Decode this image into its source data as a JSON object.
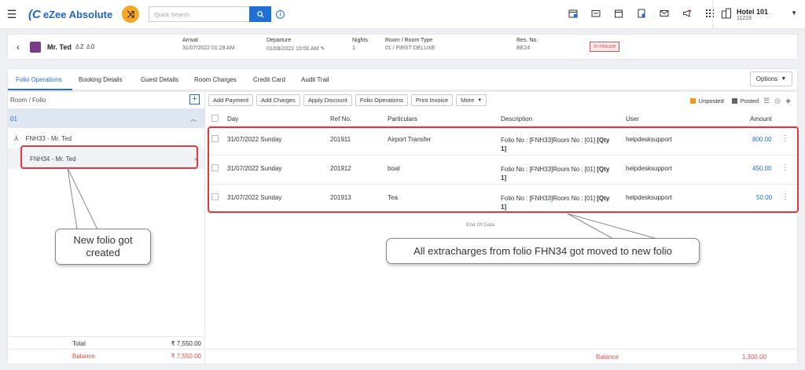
{
  "topbar": {
    "brand": "eZee Absolute",
    "search_placeholder": "Quick Search",
    "hotel_name": "Hotel 101",
    "hotel_code": "11219"
  },
  "guest": {
    "name": "Mr. Ted",
    "adults": "2",
    "children": "0",
    "arrival_label": "Arrival",
    "arrival_value": "31/07/2022 01:28 AM",
    "departure_label": "Departure",
    "departure_value": "01/08/2022 10:00 AM",
    "nights_label": "Nights",
    "nights_value": "1",
    "room_label": "Room / Room Type",
    "room_value": "01 / FIRST DELUXE",
    "resno_label": "Res. No.",
    "resno_value": "BE24",
    "status": "In-House"
  },
  "tabs": [
    {
      "label": "Folio Operations"
    },
    {
      "label": "Booking Details"
    },
    {
      "label": "Guest Details"
    },
    {
      "label": "Room Charges"
    },
    {
      "label": "Credit Card"
    },
    {
      "label": "Audit Trail"
    }
  ],
  "options_label": "Options",
  "left_panel": {
    "header": "Room / Folio",
    "group": "01",
    "folios": [
      "FNH33 - Mr. Ted",
      "FNH34 - Mr. Ted"
    ],
    "total_label": "Total",
    "total_value": "₹ 7,550.00",
    "balance_label": "Balance",
    "balance_value": "₹ 7,550.00"
  },
  "actions": [
    "Add Payment",
    "Add Charges",
    "Apply Discount",
    "Folio Operations",
    "Print Invoice",
    "More"
  ],
  "legend": {
    "unposted": "Unposted",
    "posted": "Posted"
  },
  "table": {
    "headers": {
      "day": "Day",
      "ref": "Ref No.",
      "particulars": "Particulars",
      "description": "Description",
      "user": "User",
      "amount": "Amount"
    },
    "rows": [
      {
        "day": "31/07/2022 Sunday",
        "ref": "201911",
        "particulars": "Airport Transfer",
        "desc_a": "Folio No : [FNH33]Room No : [01] ",
        "desc_b": "[Qty",
        "desc_c": "1]",
        "user": "helpdesksupport",
        "amount": "800.00"
      },
      {
        "day": "31/07/2022 Sunday",
        "ref": "201912",
        "particulars": "boat",
        "desc_a": "Folio No : [FNH33]Room No : [01] ",
        "desc_b": "[Qty",
        "desc_c": "1]",
        "user": "helpdesksupport",
        "amount": "450.00"
      },
      {
        "day": "31/07/2022 Sunday",
        "ref": "201913",
        "particulars": "Tea",
        "desc_a": "Folio No : [FNH33]Room No : [01] ",
        "desc_b": "[Qty",
        "desc_c": "1]",
        "user": "helpdesksupport",
        "amount": "50.00"
      }
    ],
    "end_text": "End Of Data",
    "balance_label": "Balance",
    "balance_value": "1,300.00"
  },
  "annotations": {
    "new_folio": "New folio got created",
    "moved": "All extracharges from folio FHN34 got moved to new folio"
  },
  "colors": {
    "accent": "#1f6fd6",
    "highlight": "#e0383e",
    "unposted": "#f39c12"
  }
}
